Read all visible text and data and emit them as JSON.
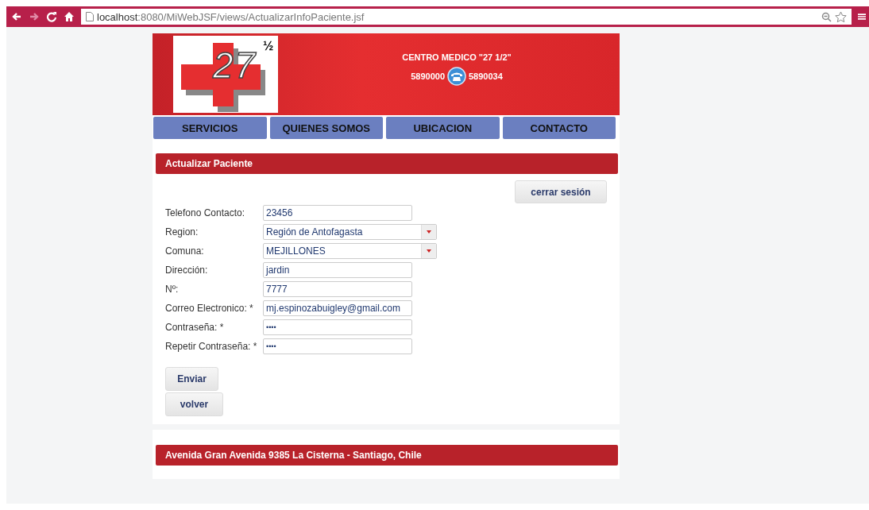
{
  "browser": {
    "url_host": "localhost",
    "url_path": ":8080/MiWebJSF/views/ActualizarInfoPaciente.jsf"
  },
  "header": {
    "logo_number": "27",
    "logo_fraction": "½",
    "title": "CENTRO MEDICO \"27 1/2\"",
    "phone_1": "5890000",
    "phone_2": "5890034"
  },
  "nav": [
    {
      "label": "SERVICIOS"
    },
    {
      "label": "QUIENES SOMOS"
    },
    {
      "label": "UBICACION"
    },
    {
      "label": "CONTACTO"
    }
  ],
  "panel": {
    "title": "Actualizar Paciente",
    "logout_button": "cerrar sesión"
  },
  "fields": [
    {
      "label": "Telefono Contacto:",
      "kind": "text",
      "value": "23456"
    },
    {
      "label": "Region:",
      "kind": "select",
      "value": "Región de Antofagasta"
    },
    {
      "label": "Comuna:",
      "kind": "select",
      "value": "MEJILLONES"
    },
    {
      "label": "Dirección:",
      "kind": "text",
      "value": "jardin"
    },
    {
      "label": "Nº:",
      "kind": "text",
      "value": "7777"
    },
    {
      "label": "Correo Electronico: *",
      "kind": "text",
      "value": "mj.espinozabuigley@gmail.com"
    },
    {
      "label": "Contraseña: *",
      "kind": "password",
      "value": "••••"
    },
    {
      "label": "Repetir Contraseña: *",
      "kind": "password",
      "value": "••••"
    }
  ],
  "buttons": [
    "Enviar",
    "volver"
  ],
  "footer": {
    "address": "Avenida Gran Avenida 9385 La Cisterna - Santiago, Chile"
  }
}
